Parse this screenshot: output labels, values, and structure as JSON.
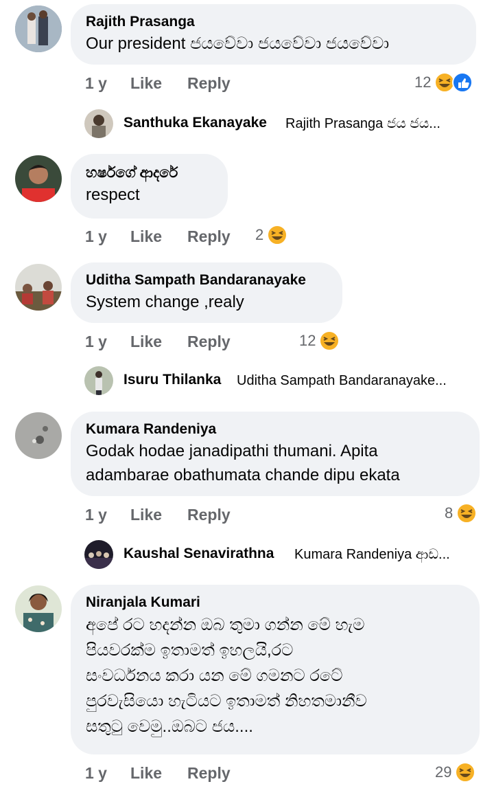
{
  "comments": [
    {
      "author": "Rajith Prasanga",
      "text": "Our president ජයවේවා ජයවේවා ජයවේවා",
      "time": "1 y",
      "like": "Like",
      "reply": "Reply",
      "reaction_count": "12",
      "reactions": [
        "haha-icon",
        "like-icon"
      ],
      "reply_preview": {
        "name": "Santhuka Ekanayake",
        "text": "Rajith Prasanga ජය ජය..."
      }
    },
    {
      "author": "හර්ෂගේ ආදරේ",
      "text": "respect",
      "time": "1 y",
      "like": "Like",
      "reply": "Reply",
      "reaction_count": "2",
      "reactions": [
        "haha-icon"
      ]
    },
    {
      "author": "Uditha Sampath Bandaranayake",
      "text": "System change ,realy",
      "time": "1 y",
      "like": "Like",
      "reply": "Reply",
      "reaction_count": "12",
      "reactions": [
        "haha-icon"
      ],
      "reply_preview": {
        "name": "Isuru Thilanka",
        "text": "Uditha Sampath Bandaranayake..."
      }
    },
    {
      "author": "Kumara Randeniya",
      "text": "Godak hodae janadipathi thumani. Apita\nadambarae obathumata chande dipu ekata",
      "time": "1 y",
      "like": "Like",
      "reply": "Reply",
      "reaction_count": "8",
      "reactions": [
        "haha-icon"
      ],
      "reply_preview": {
        "name": "Kaushal Senavirathna",
        "text": "Kumara Randeniya ආඩ..."
      }
    },
    {
      "author": "Niranjala Kumari",
      "text": "අපේ රට හදන්න ඔබ තුමා ගන්න මේ හැම\nපියවරක්ම ඉතාමත් ඉහලයි,රට\nසංවර්ධනය කරා යන මේ ගමනට රටේ\nපුරවැසියො හැටියට ඉතාමත් නිහතමානීව\nසතුටු වෙමු..ඔබට ජය....",
      "time": "1 y",
      "like": "Like",
      "reply": "Reply",
      "reaction_count": "29",
      "reactions": [
        "haha-icon"
      ]
    }
  ],
  "colors": {
    "bubble": "#f0f2f5",
    "meta": "#65676b",
    "like_blue": "#1877f2",
    "haha_yellow": "#f7b125"
  }
}
